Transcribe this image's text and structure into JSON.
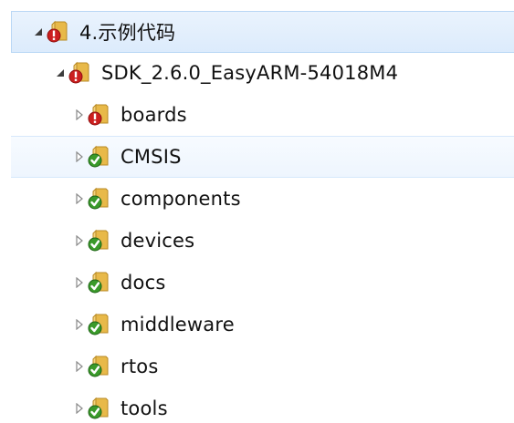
{
  "tree": {
    "root": {
      "label": "4.示例代码",
      "status": "error",
      "expanded": true
    },
    "project": {
      "label": "SDK_2.6.0_EasyARM-54018M4",
      "status": "error",
      "expanded": true
    },
    "children": [
      {
        "label": "boards",
        "status": "error",
        "expanded": false
      },
      {
        "label": "CMSIS",
        "status": "ok",
        "expanded": false
      },
      {
        "label": "components",
        "status": "ok",
        "expanded": false
      },
      {
        "label": "devices",
        "status": "ok",
        "expanded": false
      },
      {
        "label": "docs",
        "status": "ok",
        "expanded": false
      },
      {
        "label": "middleware",
        "status": "ok",
        "expanded": false
      },
      {
        "label": "rtos",
        "status": "ok",
        "expanded": false
      },
      {
        "label": "tools",
        "status": "ok",
        "expanded": false
      }
    ]
  },
  "colors": {
    "selected_bg": "#dcebfc",
    "hover_bg": "#eef5fe",
    "error_badge": "#cc1f1f",
    "ok_badge": "#3a9a2a",
    "folder": "#e8b949"
  },
  "icons": {
    "expanded": "expanded-triangle-icon",
    "collapsed": "collapsed-triangle-icon",
    "error": "folder-conflict-icon",
    "ok": "folder-ok-icon"
  }
}
